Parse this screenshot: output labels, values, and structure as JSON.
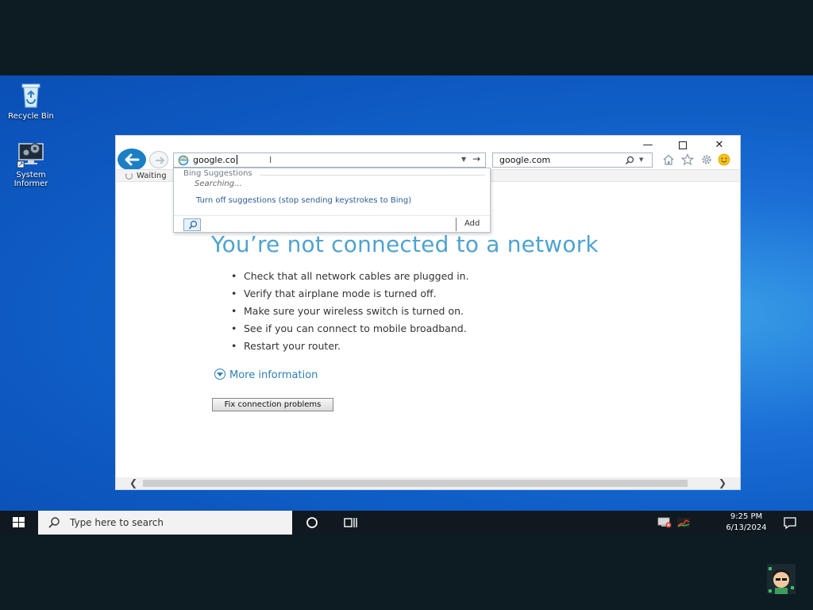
{
  "desktop": {
    "icons": [
      {
        "label": "Recycle Bin",
        "icon": "recycle-bin-icon"
      },
      {
        "label": "System Informer",
        "icon": "system-informer-icon"
      }
    ]
  },
  "browser": {
    "address": {
      "value": "google.co",
      "icon": "ie-page-icon"
    },
    "search": {
      "value": "google.com"
    },
    "tab": {
      "label": "Waiting"
    },
    "suggestions": {
      "header": "Bing Suggestions",
      "status": "Searching...",
      "turn_off": "Turn off suggestions (stop sending keystrokes to Bing)",
      "add": "Add"
    },
    "page": {
      "title": "You’re not connected to a network",
      "items": [
        "Check that all network cables are plugged in.",
        "Verify that airplane mode is turned off.",
        "Make sure your wireless switch is turned on.",
        "See if you can connect to mobile broadband.",
        "Restart your router."
      ],
      "more_info": "More information",
      "fix_button": "Fix connection problems"
    }
  },
  "taskbar": {
    "search_placeholder": "Type here to search",
    "time": "9:25 PM",
    "date": "6/13/2024"
  },
  "colors": {
    "accent": "#1b7fc4",
    "title_blue": "#4fa3cf",
    "link_blue": "#2d81b5"
  }
}
